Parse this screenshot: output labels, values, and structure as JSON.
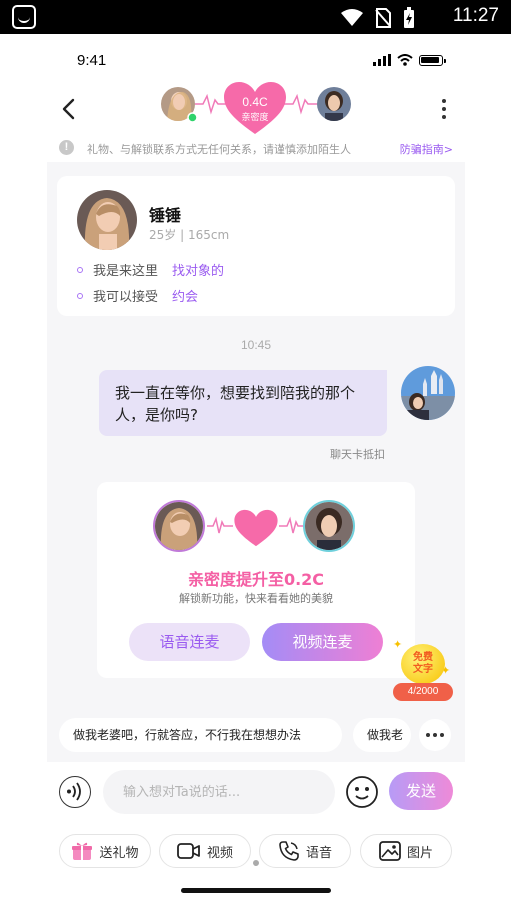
{
  "android_status": {
    "time": "11:27"
  },
  "ios_status": {
    "time": "9:41"
  },
  "header": {
    "intimacy_value": "0.4C",
    "intimacy_label": "亲密度"
  },
  "notice": {
    "text": "礼物、与解锁联系方式无任何关系，请谨慎添加陌生人",
    "link": "防骗指南>"
  },
  "profile": {
    "name": "锤锤",
    "meta": "25岁 | 165cm",
    "prefs": [
      {
        "label": "我是来这里",
        "value": "找对象的"
      },
      {
        "label": "我可以接受",
        "value": "约会"
      }
    ]
  },
  "chat": {
    "timestamp": "10:45",
    "message": "我一直在等你，想要找到陪我的那个人，是你吗?",
    "deduct_note": "聊天卡抵扣"
  },
  "intimacy_card": {
    "title": "亲密度提升至0.2C",
    "subtitle": "解锁新功能，快来看看她的美貌",
    "voice_button": "语音连麦",
    "video_button": "视频连麦"
  },
  "free_text": {
    "label_line1": "免费",
    "label_line2": "文字",
    "count": "4/2000"
  },
  "quick_replies": [
    "做我老婆吧，行就答应，不行我在想想办法",
    "做我老"
  ],
  "input": {
    "placeholder": "输入想对Ta说的话...",
    "send_label": "发送"
  },
  "actions": {
    "gift": "送礼物",
    "video": "视频",
    "voice": "语音",
    "image": "图片"
  },
  "colors": {
    "accent": "#9a5bf0",
    "pink": "#f45fa4",
    "bubble": "#e7e2f7",
    "online": "#2fd36b"
  }
}
